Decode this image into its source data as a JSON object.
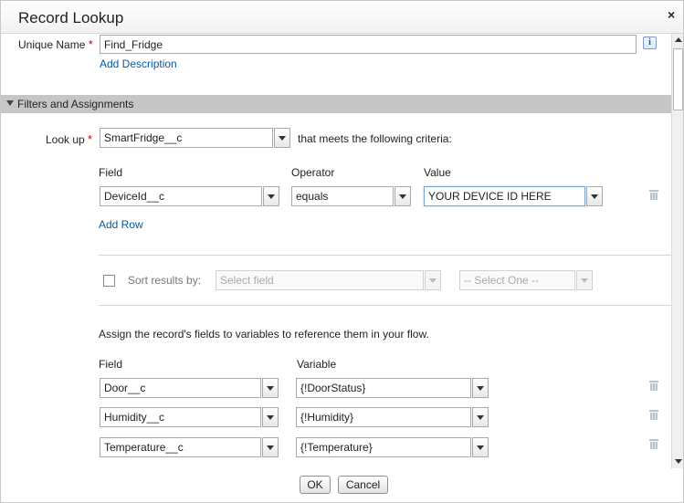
{
  "dialog": {
    "title": "Record Lookup",
    "close_label": "×"
  },
  "general": {
    "unique_name_label": "Unique Name",
    "required_marker": "*",
    "unique_name_value": "Find_Fridge",
    "add_description_link": "Add Description",
    "info_icon_glyph": "i"
  },
  "filters": {
    "section_title": "Filters and Assignments",
    "lookup_label": "Look up",
    "lookup_object": "SmartFridge__c",
    "criteria_text": "that meets the following criteria:",
    "headers": {
      "field": "Field",
      "operator": "Operator",
      "value": "Value"
    },
    "rows": [
      {
        "field": "DeviceId__c",
        "operator": "equals",
        "value": "YOUR DEVICE ID HERE"
      }
    ],
    "add_row_link": "Add Row"
  },
  "sort": {
    "label": "Sort results by:",
    "field_placeholder": "Select field",
    "order_placeholder": "-- Select One --"
  },
  "assignments": {
    "intro": "Assign the record's fields to variables to reference them in your flow.",
    "headers": {
      "field": "Field",
      "variable": "Variable"
    },
    "rows": [
      {
        "field": "Door__c",
        "variable": "{!DoorStatus}"
      },
      {
        "field": "Humidity__c",
        "variable": "{!Humidity}"
      },
      {
        "field": "Temperature__c",
        "variable": "{!Temperature}"
      }
    ]
  },
  "buttons": {
    "ok": "OK",
    "cancel": "Cancel"
  },
  "colors": {
    "link": "#015ba7",
    "required": "#cc0000",
    "section_bar": "#c6c6c6"
  }
}
